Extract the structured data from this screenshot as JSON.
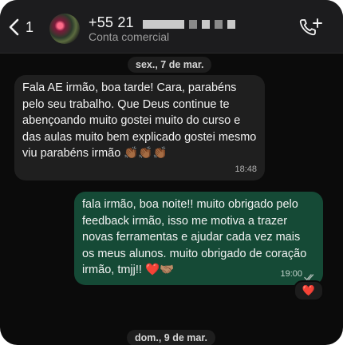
{
  "header": {
    "back_count": "1",
    "contact_name": "+55 21",
    "contact_subtitle": "Conta comercial"
  },
  "dates": {
    "first": "sex., 7 de mar.",
    "second": "dom., 9 de mar."
  },
  "messages": {
    "incoming": {
      "text": "Fala AE irmão, boa tarde! Cara, parabéns pelo seu trabalho. Que Deus continue te abençoando muito gostei muito do curso e das aulas muito bem explicado gostei mesmo viu parabéns irmão 👏🏾👏🏾👏🏾",
      "time": "18:48"
    },
    "outgoing": {
      "text": "fala irmão, boa noite!! muito obrigado pelo feedback irmão, isso me motiva a trazer novas ferramentas e ajudar cada vez mais os meus alunos. muito obrigado de coração irmão, tmjj!! ❤️🤝🏽",
      "time": "19:00",
      "reaction": "❤️"
    }
  },
  "colors": {
    "incoming_bubble": "#1f1f1f",
    "outgoing_bubble": "#154a36",
    "background": "#0b0b0b",
    "read_ticks": "#a9b8b2"
  },
  "icons": [
    "back-chevron-icon",
    "avatar",
    "add-call-icon",
    "read-ticks-icon"
  ]
}
